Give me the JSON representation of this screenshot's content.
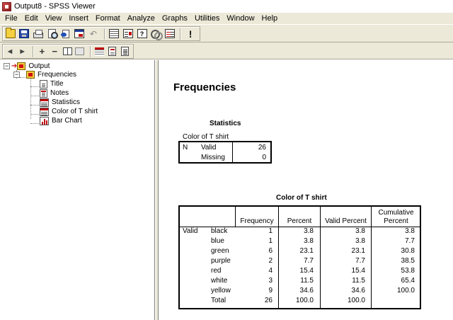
{
  "window": {
    "title": "Output8 - SPSS Viewer"
  },
  "menu": [
    "File",
    "Edit",
    "View",
    "Insert",
    "Format",
    "Analyze",
    "Graphs",
    "Utilities",
    "Window",
    "Help"
  ],
  "toolbar": {
    "main_icons": [
      "open-icon",
      "save-icon",
      "print-icon",
      "print-preview-icon",
      "export-icon",
      "recall-dialog-icon",
      "undo-icon",
      "goto-data-icon",
      "variables-icon",
      "help-topic-icon",
      "use-sets-icon",
      "select-cases-icon",
      "designate-window-icon"
    ],
    "nav_icons": [
      "promote-icon",
      "demote-icon",
      "expand-icon",
      "collapse-icon",
      "show-icon",
      "hide-icon",
      "insert-heading-icon",
      "insert-title-icon",
      "insert-text-icon"
    ],
    "nav_glyphs": {
      "promote": "◄",
      "demote": "►",
      "expand": "+",
      "collapse": "−",
      "designate": "!",
      "undo": "↶",
      "help": "?"
    }
  },
  "outline": {
    "root": "Output",
    "section": "Frequencies",
    "items": [
      "Title",
      "Notes",
      "Statistics",
      "Color of T shirt",
      "Bar Chart"
    ],
    "expand_glyph": "−"
  },
  "content": {
    "heading": "Frequencies",
    "statistics": {
      "caption": "Statistics",
      "variable": "Color of T shirt",
      "n_label": "N",
      "valid_label": "Valid",
      "missing_label": "Missing",
      "valid_value": "26",
      "missing_value": "0"
    },
    "frequency_table": {
      "caption": "Color of T shirt",
      "headers": {
        "frequency": "Frequency",
        "percent": "Percent",
        "valid_percent": "Valid Percent",
        "cumulative_line1": "Cumulative",
        "cumulative_line2": "Percent"
      },
      "group_label": "Valid",
      "rows": [
        {
          "label": "black",
          "frequency": "1",
          "percent": "3.8",
          "valid_percent": "3.8",
          "cumulative": "3.8"
        },
        {
          "label": "blue",
          "frequency": "1",
          "percent": "3.8",
          "valid_percent": "3.8",
          "cumulative": "7.7"
        },
        {
          "label": "green",
          "frequency": "6",
          "percent": "23.1",
          "valid_percent": "23.1",
          "cumulative": "30.8"
        },
        {
          "label": "purple",
          "frequency": "2",
          "percent": "7.7",
          "valid_percent": "7.7",
          "cumulative": "38.5"
        },
        {
          "label": "red",
          "frequency": "4",
          "percent": "15.4",
          "valid_percent": "15.4",
          "cumulative": "53.8"
        },
        {
          "label": "white",
          "frequency": "3",
          "percent": "11.5",
          "valid_percent": "11.5",
          "cumulative": "65.4"
        },
        {
          "label": "yellow",
          "frequency": "9",
          "percent": "34.6",
          "valid_percent": "34.6",
          "cumulative": "100.0"
        },
        {
          "label": "Total",
          "frequency": "26",
          "percent": "100.0",
          "valid_percent": "100.0",
          "cumulative": ""
        }
      ]
    }
  },
  "colors": {
    "chrome": "#ece9d8",
    "accent_red": "#d01010",
    "folder": "#f5d040"
  }
}
